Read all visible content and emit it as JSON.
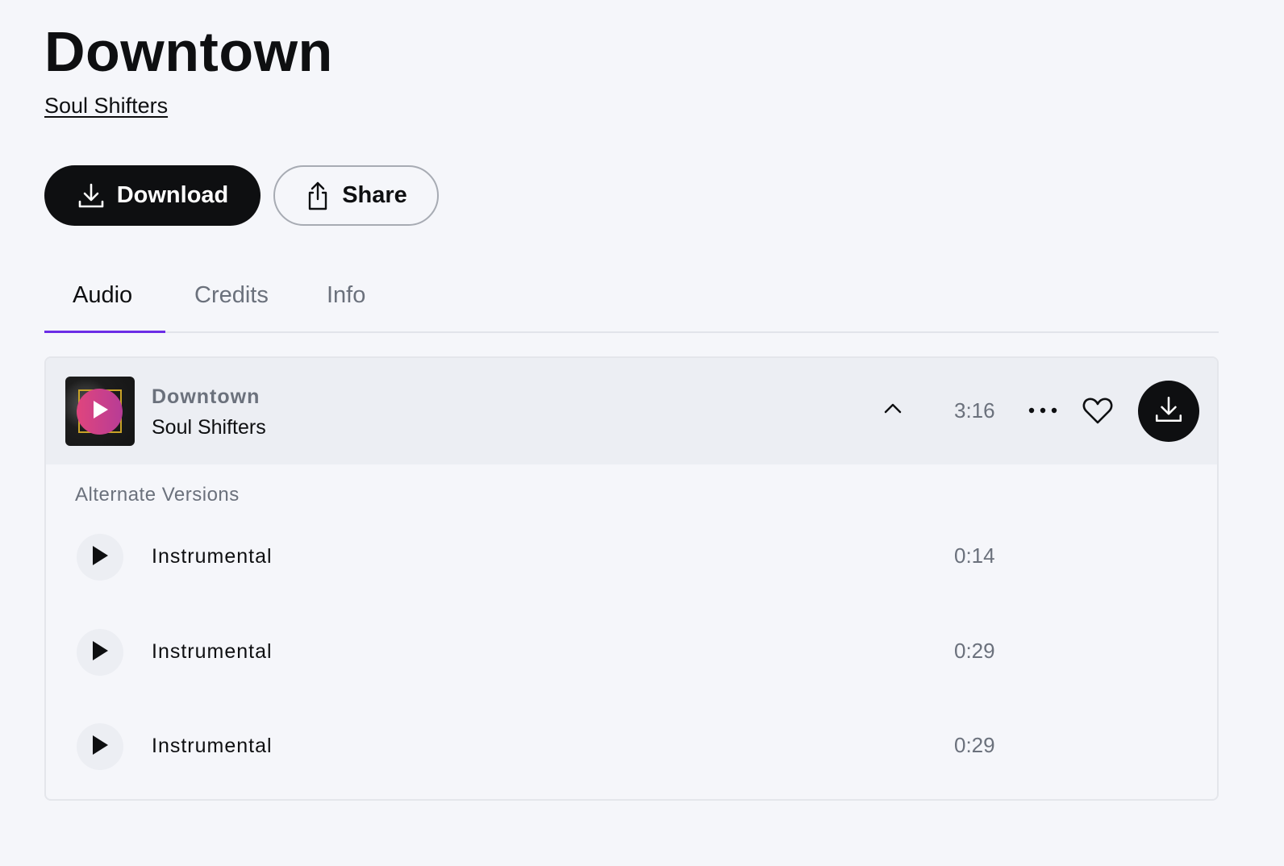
{
  "header": {
    "title": "Downtown",
    "artist": "Soul Shifters"
  },
  "actions": {
    "download_label": "Download",
    "share_label": "Share"
  },
  "tabs": [
    {
      "label": "Audio",
      "active": true
    },
    {
      "label": "Credits",
      "active": false
    },
    {
      "label": "Info",
      "active": false
    }
  ],
  "track": {
    "title": "Downtown",
    "artist": "Soul Shifters",
    "duration": "3:16",
    "icons": {
      "collapse": "chevron-up-icon",
      "more": "more-horizontal-icon",
      "favorite": "heart-icon",
      "download": "download-icon",
      "play": "play-icon"
    }
  },
  "alternate_versions": {
    "heading": "Alternate Versions",
    "items": [
      {
        "name": "Instrumental",
        "duration": "0:14"
      },
      {
        "name": "Instrumental",
        "duration": "0:29"
      },
      {
        "name": "Instrumental",
        "duration": "0:29"
      }
    ]
  },
  "colors": {
    "accent": "#6b2ce6",
    "primary_button": "#0e0f11",
    "play_gradient_start": "#e0457d",
    "play_gradient_end": "#b73c96",
    "muted_text": "#6b717c",
    "background": "#f5f6fa"
  }
}
